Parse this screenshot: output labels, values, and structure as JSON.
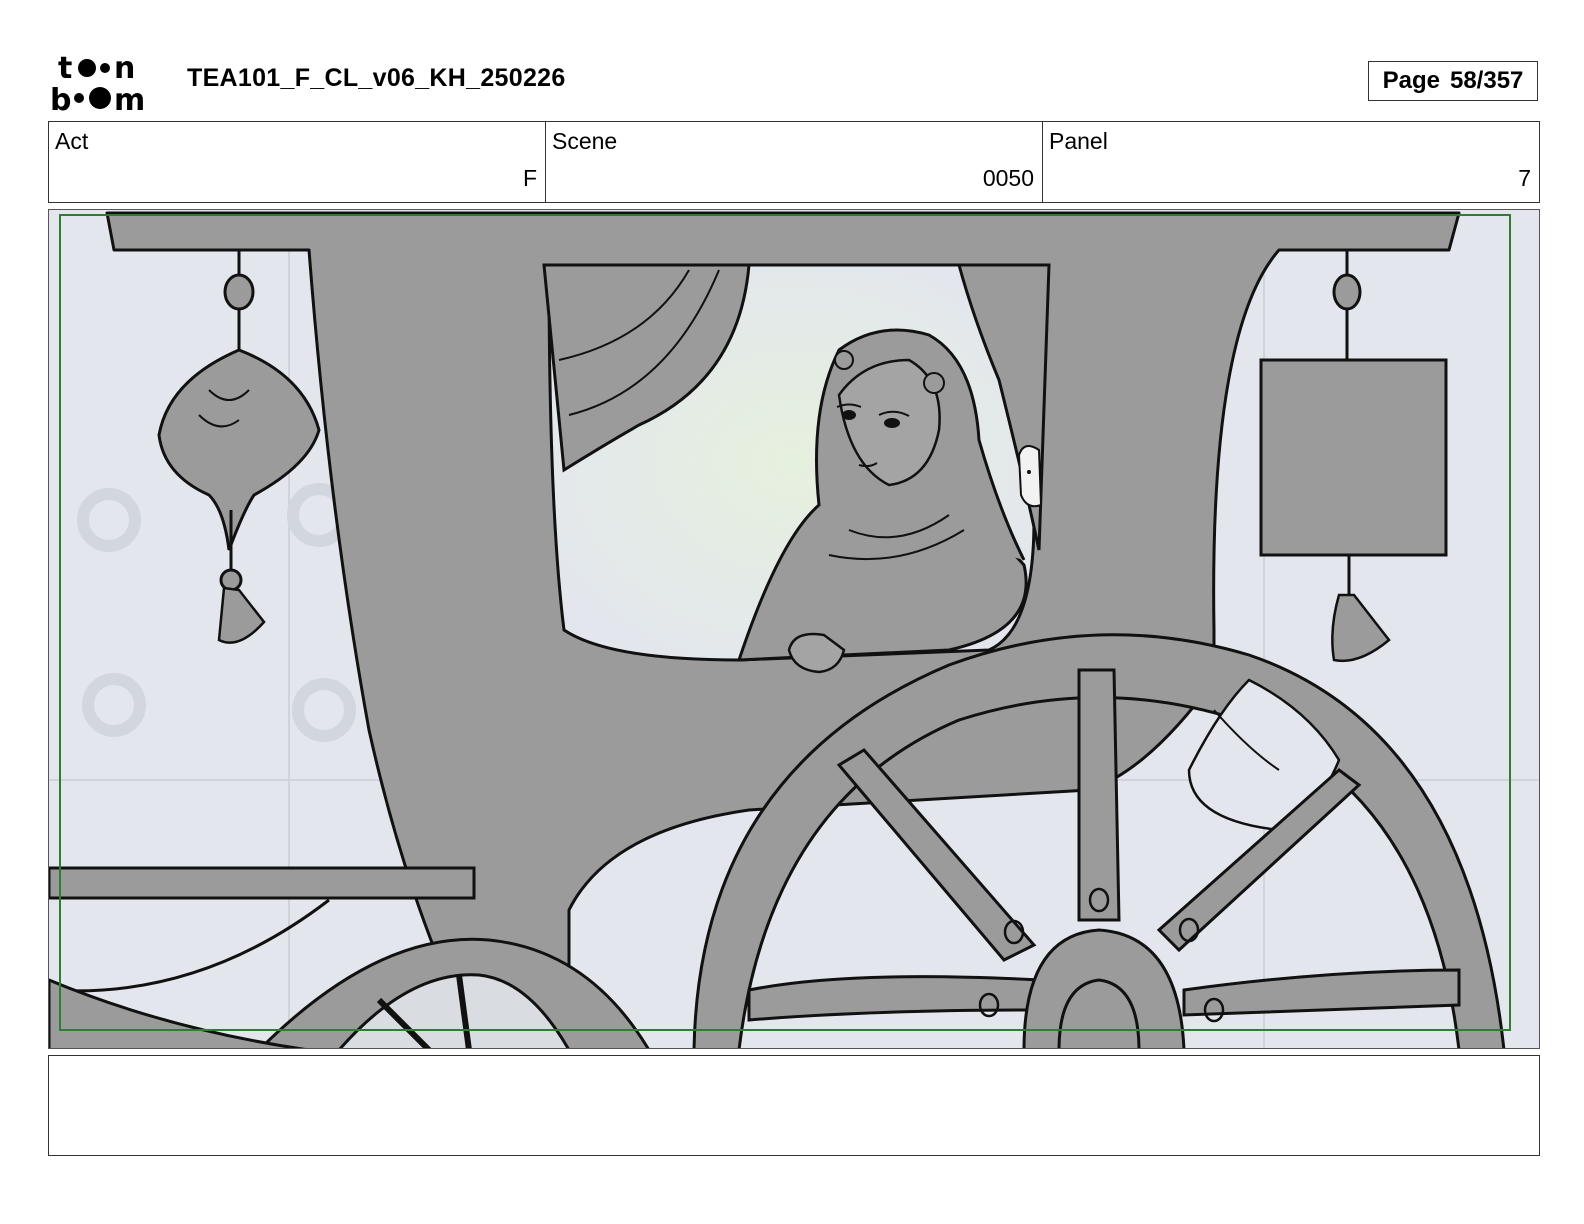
{
  "header": {
    "logo_alt": "toon boom",
    "logo_icon": "toon-boom-logo",
    "document_title": "TEA101_F_CL_v06_KH_250226",
    "page_label": "Page",
    "page_number": "58/357"
  },
  "info": {
    "act_label": "Act",
    "act_value": "F",
    "scene_label": "Scene",
    "scene_value": "0050",
    "panel_label": "Panel",
    "panel_value": "7"
  },
  "panel_image": {
    "description_icon": "storyboard-sketch-image",
    "colors": {
      "background": "#e3e7ed",
      "fill": "#9b9b9b",
      "ink": "#111111",
      "safe_frame": "#2e7d32",
      "window_glow": "#eef3ea"
    }
  },
  "notes": {
    "text": ""
  }
}
